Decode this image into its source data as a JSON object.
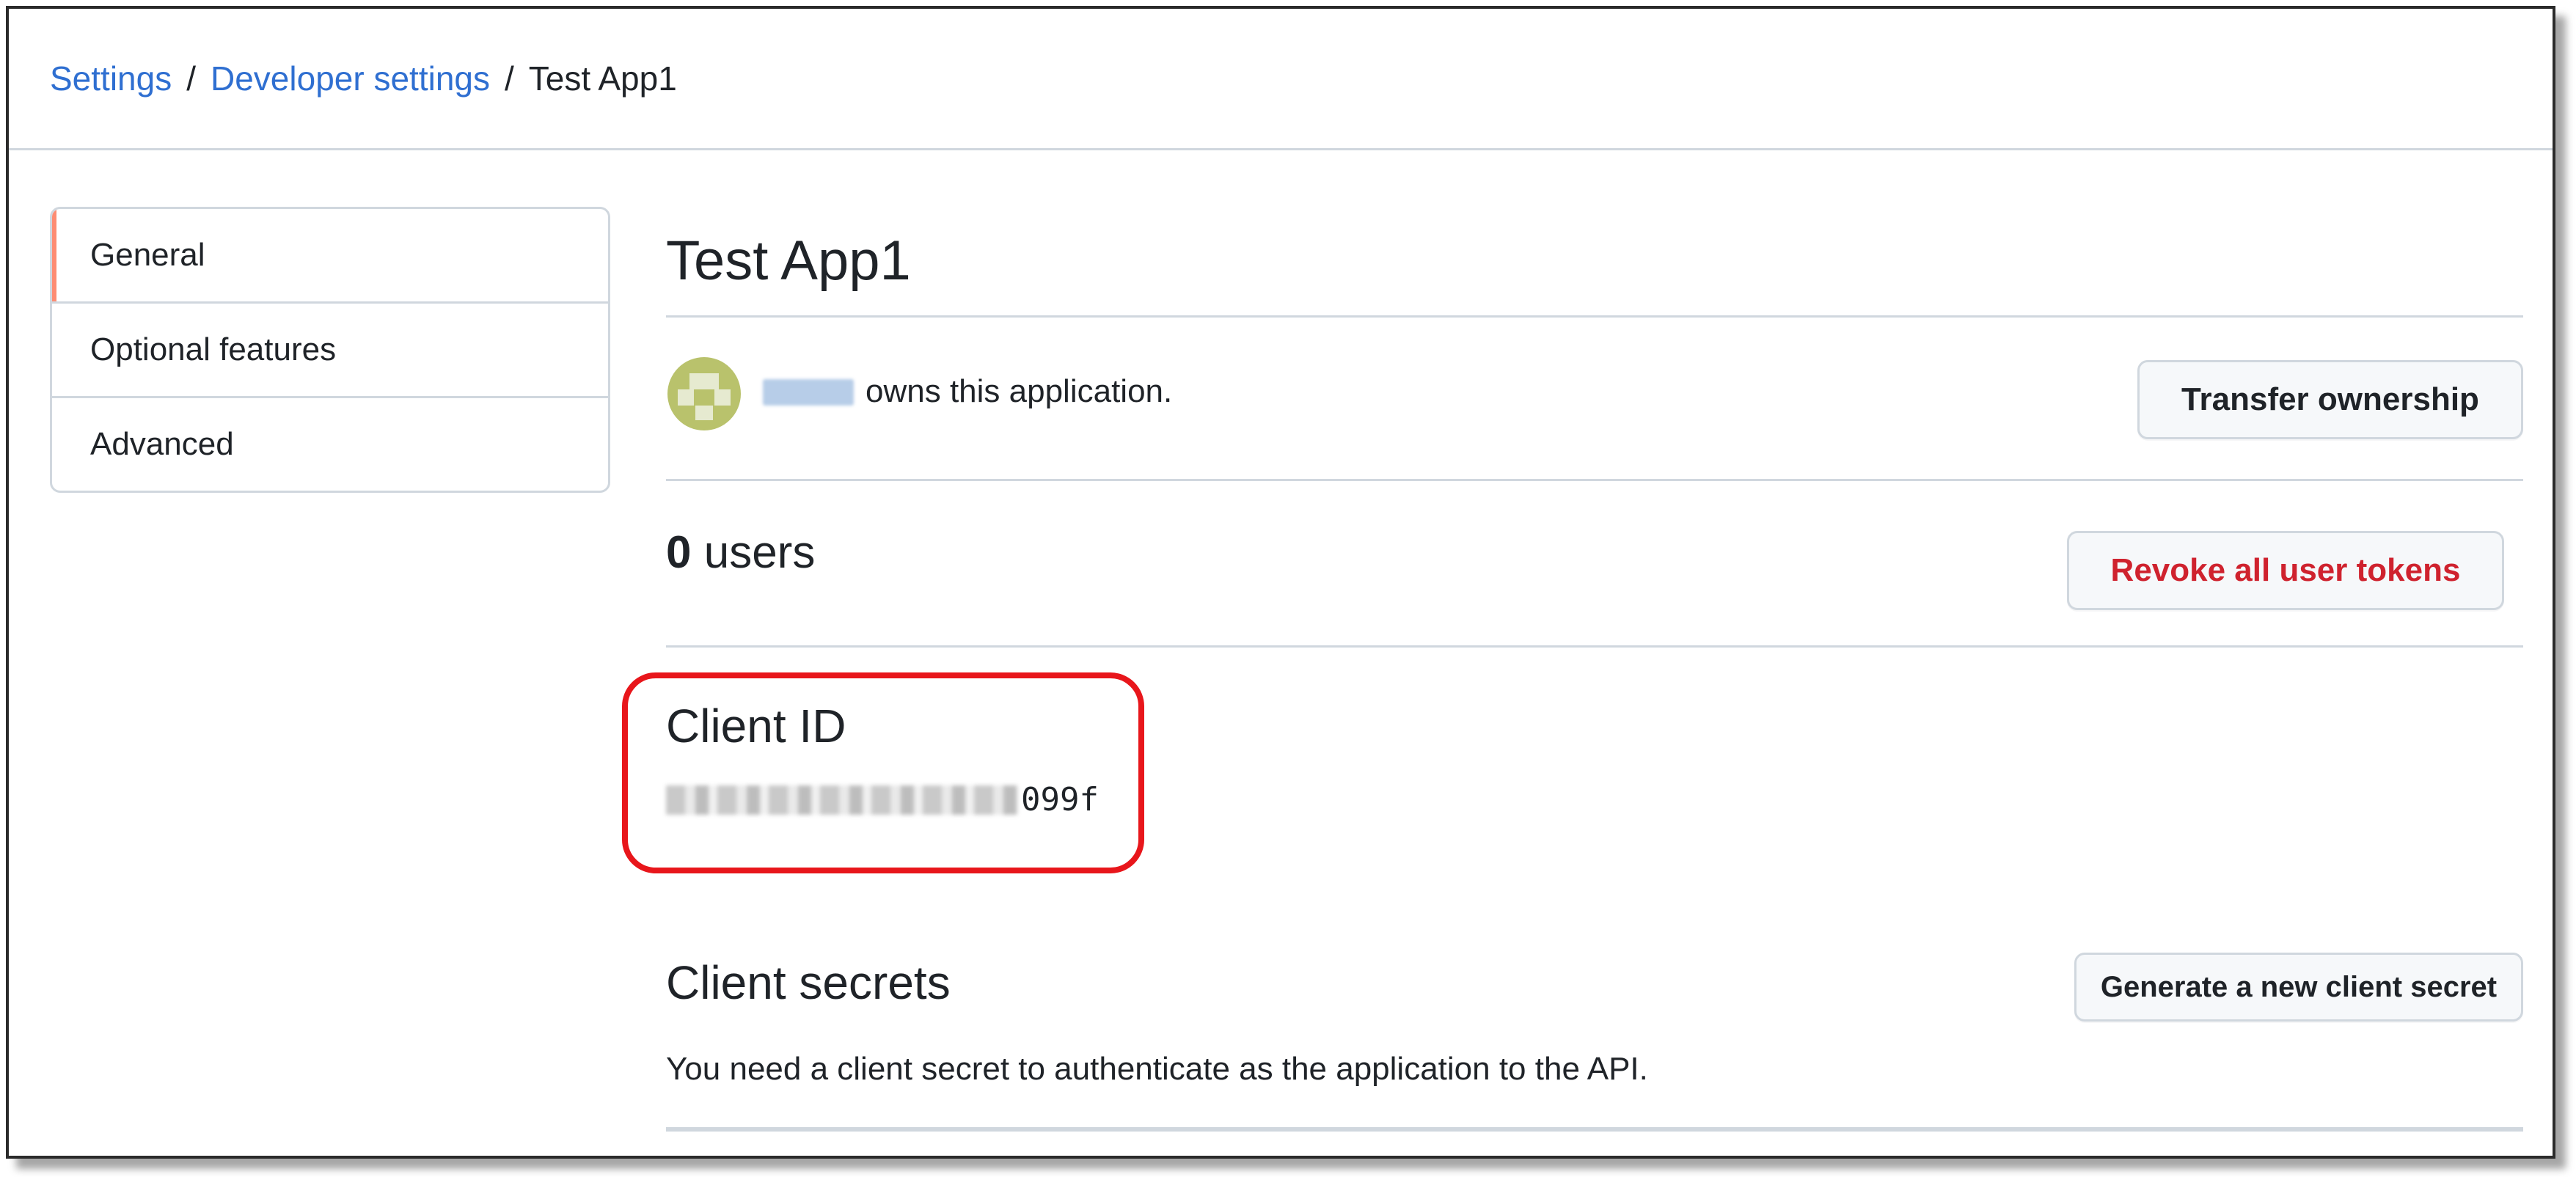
{
  "breadcrumb": {
    "settings": "Settings",
    "separator": "/",
    "developer_settings": "Developer settings",
    "current": "Test App1"
  },
  "sidebar": {
    "items": [
      {
        "label": "General",
        "active": true
      },
      {
        "label": "Optional features",
        "active": false
      },
      {
        "label": "Advanced",
        "active": false
      }
    ]
  },
  "main": {
    "title": "Test App1",
    "owner_text": "owns this application.",
    "transfer_button": "Transfer ownership",
    "users_count": "0",
    "users_label": "users",
    "revoke_button": "Revoke all user tokens",
    "client_id_label": "Client ID",
    "client_id_visible_suffix": "099f",
    "client_secrets_title": "Client secrets",
    "generate_secret_button": "Generate a new client secret",
    "client_secrets_description": "You need a client secret to authenticate as the application to the API."
  },
  "colors": {
    "link": "#2f6fd1",
    "danger": "#cf222e",
    "active_nav_accent": "#fd8c73",
    "highlight_box": "#e8161b",
    "border": "#d0d7de"
  }
}
